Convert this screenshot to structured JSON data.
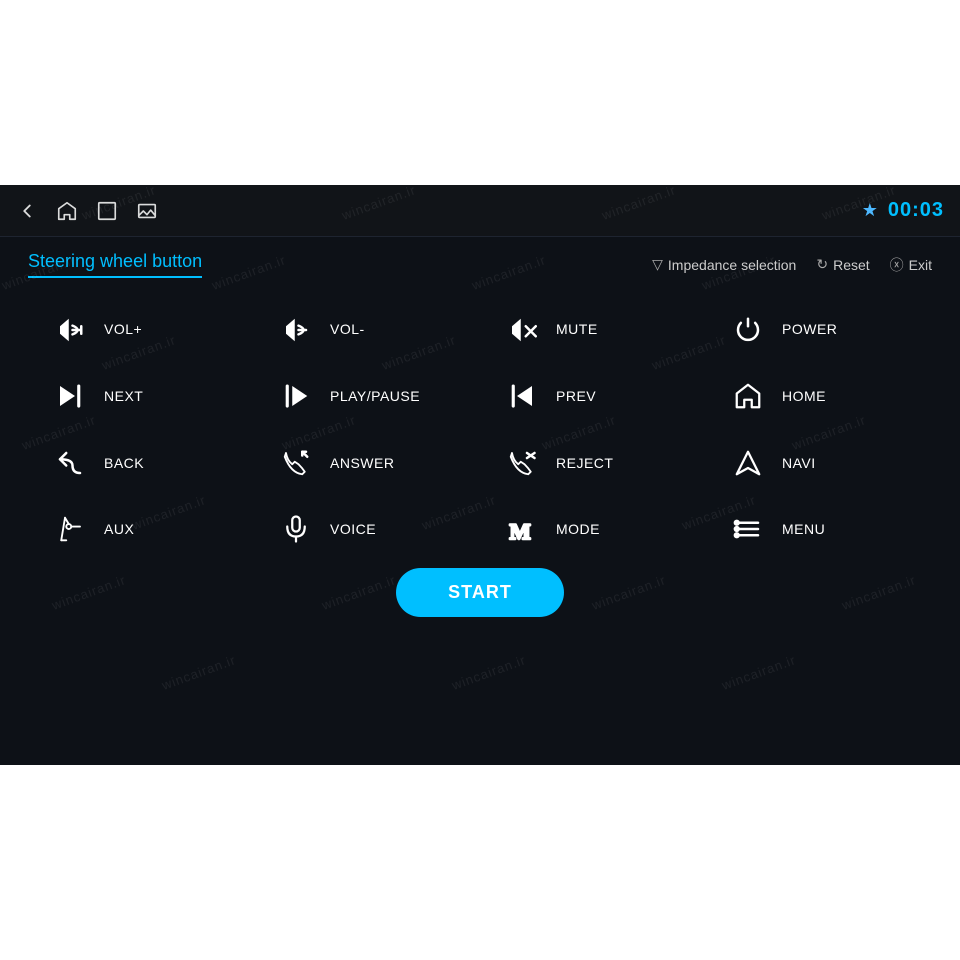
{
  "top_white_height": 185,
  "bottom_white_height": 195,
  "nav": {
    "time": "00:03",
    "icons_left": [
      "back-icon",
      "home-icon",
      "window-icon",
      "gallery-icon"
    ],
    "bluetooth_icon": "bluetooth-icon"
  },
  "header": {
    "title": "Steering wheel button",
    "actions": [
      {
        "id": "impedance",
        "label": "Impedance selection"
      },
      {
        "id": "reset",
        "label": "Reset"
      },
      {
        "id": "exit",
        "label": "Exit"
      }
    ]
  },
  "buttons": [
    {
      "id": "vol-plus",
      "label": "VOL+",
      "icon": "vol-plus"
    },
    {
      "id": "vol-minus",
      "label": "VOL-",
      "icon": "vol-minus"
    },
    {
      "id": "mute",
      "label": "MUTE",
      "icon": "mute"
    },
    {
      "id": "power",
      "label": "POWER",
      "icon": "power"
    },
    {
      "id": "next",
      "label": "NEXT",
      "icon": "next"
    },
    {
      "id": "play-pause",
      "label": "PLAY/PAUSE",
      "icon": "play-pause"
    },
    {
      "id": "prev",
      "label": "PREV",
      "icon": "prev"
    },
    {
      "id": "home",
      "label": "HOME",
      "icon": "home"
    },
    {
      "id": "back",
      "label": "BACK",
      "icon": "back"
    },
    {
      "id": "answer",
      "label": "ANSWER",
      "icon": "answer"
    },
    {
      "id": "reject",
      "label": "REJECT",
      "icon": "reject"
    },
    {
      "id": "navi",
      "label": "NAVI",
      "icon": "navi"
    },
    {
      "id": "aux",
      "label": "AUX",
      "icon": "aux"
    },
    {
      "id": "voice",
      "label": "VOICE",
      "icon": "voice"
    },
    {
      "id": "mode",
      "label": "MODE",
      "icon": "mode"
    },
    {
      "id": "menu",
      "label": "MENU",
      "icon": "menu"
    }
  ],
  "start_button": "START",
  "watermark_text": "wincairan.ir",
  "colors": {
    "accent": "#00bfff",
    "bg_dark": "#0d1117",
    "text_white": "#ffffff"
  }
}
